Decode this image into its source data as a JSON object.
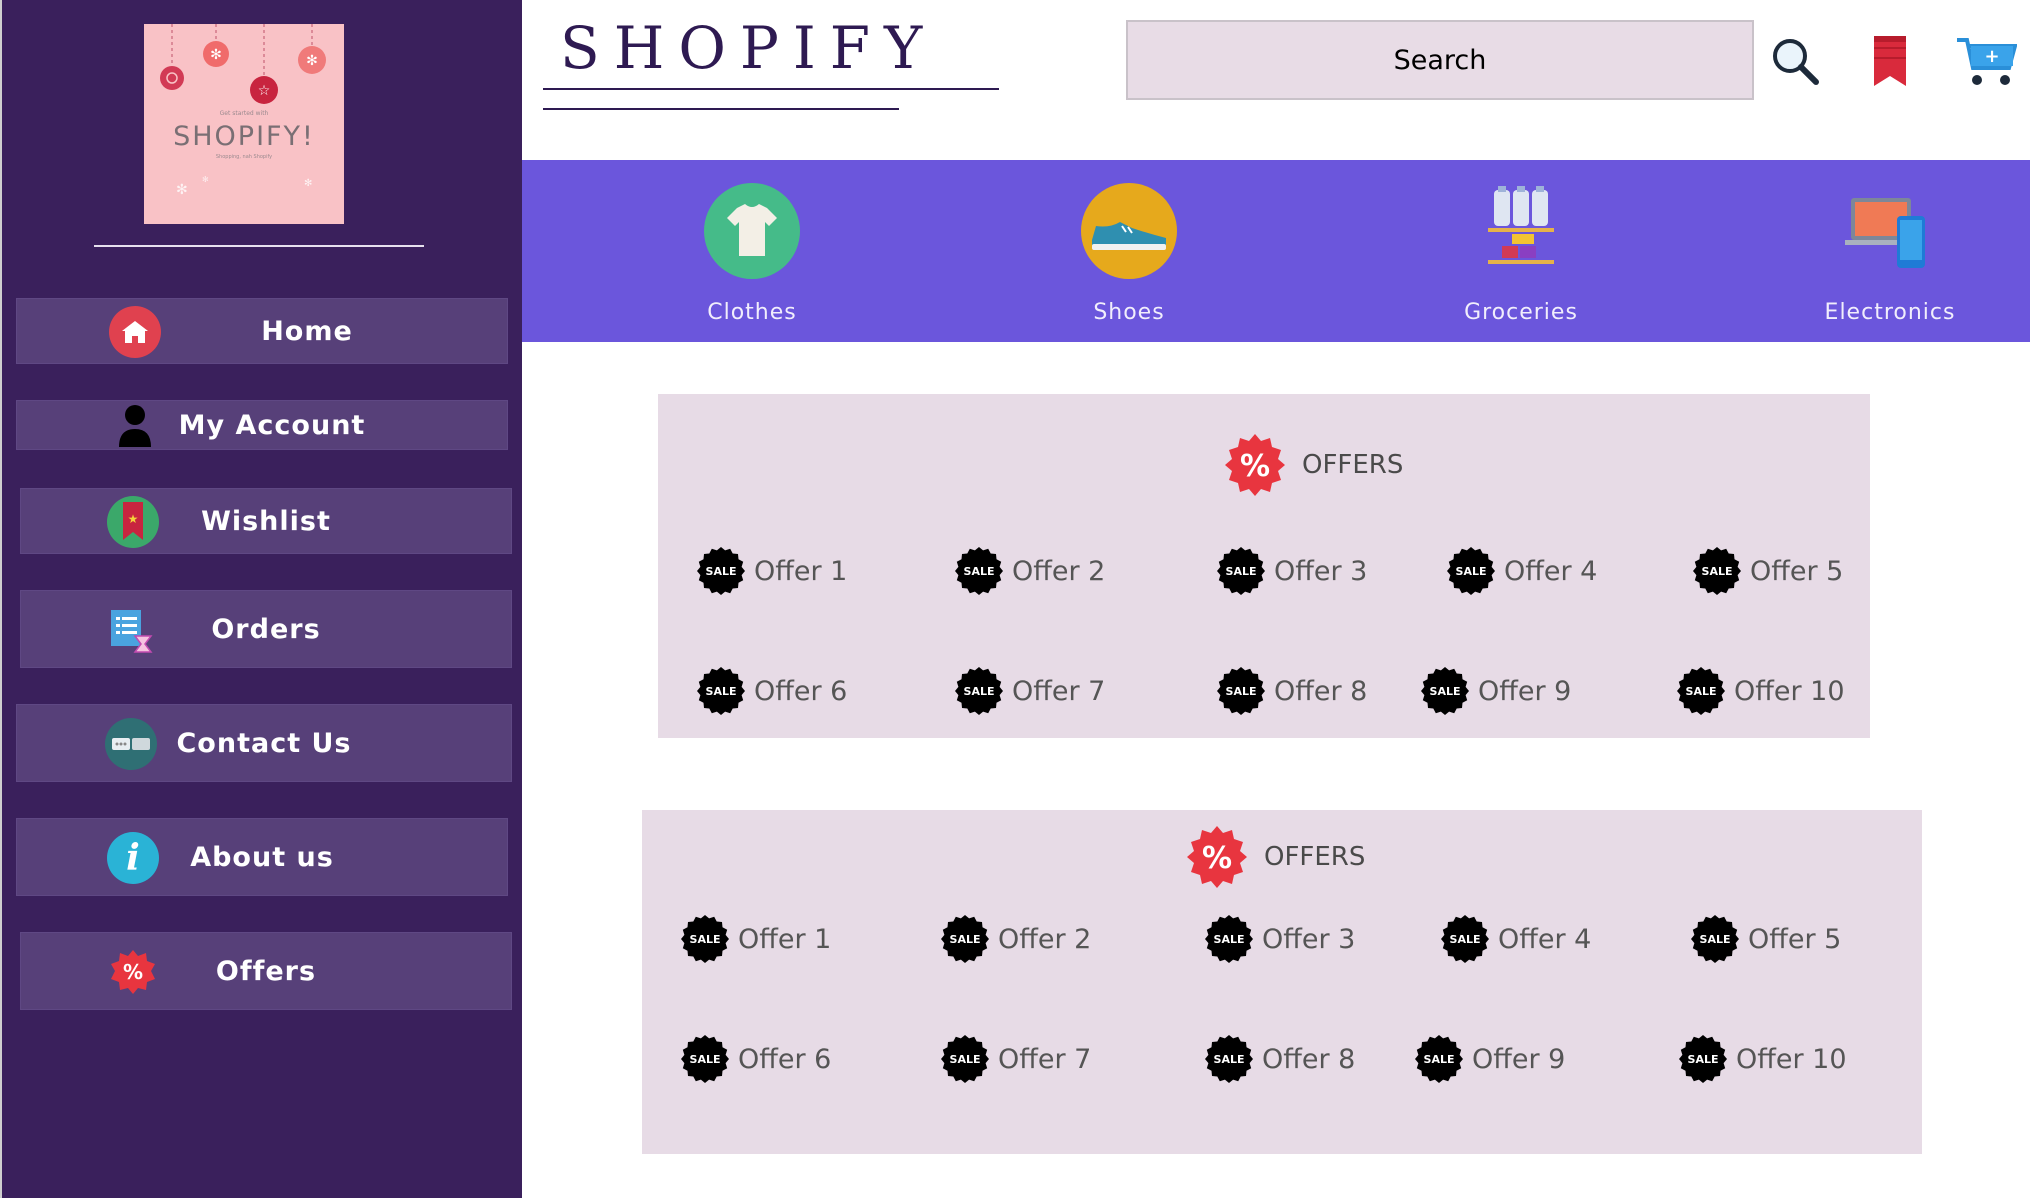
{
  "logo": {
    "text": "SHOPIFY!",
    "tagline_top": "Get started with",
    "tagline_bottom": "Shopping, nah Shopify"
  },
  "sidebar": {
    "items": [
      {
        "label": "Home",
        "icon": "home-icon"
      },
      {
        "label": "My Account",
        "icon": "person-icon"
      },
      {
        "label": "Wishlist",
        "icon": "wishlist-ribbon-icon"
      },
      {
        "label": "Orders",
        "icon": "orders-list-icon"
      },
      {
        "label": "Contact Us",
        "icon": "chat-bubbles-icon"
      },
      {
        "label": "About us",
        "icon": "info-icon"
      },
      {
        "label": "Offers",
        "icon": "percent-badge-icon"
      }
    ]
  },
  "header": {
    "brand": "SHOPIFY",
    "search_value": "Search"
  },
  "categories": [
    {
      "label": "Clothes",
      "icon": "tshirt-icon"
    },
    {
      "label": "Shoes",
      "icon": "sneaker-icon"
    },
    {
      "label": "Groceries",
      "icon": "grocery-shelf-icon"
    },
    {
      "label": "Electronics",
      "icon": "laptop-phone-icon"
    }
  ],
  "offers_sections": [
    {
      "title": "OFFERS",
      "badge": "SALE",
      "items": [
        "Offer 1",
        "Offer 2",
        "Offer 3",
        "Offer 4",
        "Offer 5",
        "Offer 6",
        "Offer 7",
        "Offer 8",
        "Offer 9",
        "Offer 10"
      ]
    },
    {
      "title": "OFFERS",
      "badge": "SALE",
      "items": [
        "Offer 1",
        "Offer 2",
        "Offer 3",
        "Offer 4",
        "Offer 5",
        "Offer 6",
        "Offer 7",
        "Offer 8",
        "Offer 9",
        "Offer 10"
      ]
    }
  ],
  "colors": {
    "sidebar_bg": "#3a205c",
    "nav_item_bg": "#574079",
    "category_bar_bg": "#6b56dc",
    "offers_panel_bg": "#e7dbe6",
    "brand_text": "#2e1a52"
  }
}
